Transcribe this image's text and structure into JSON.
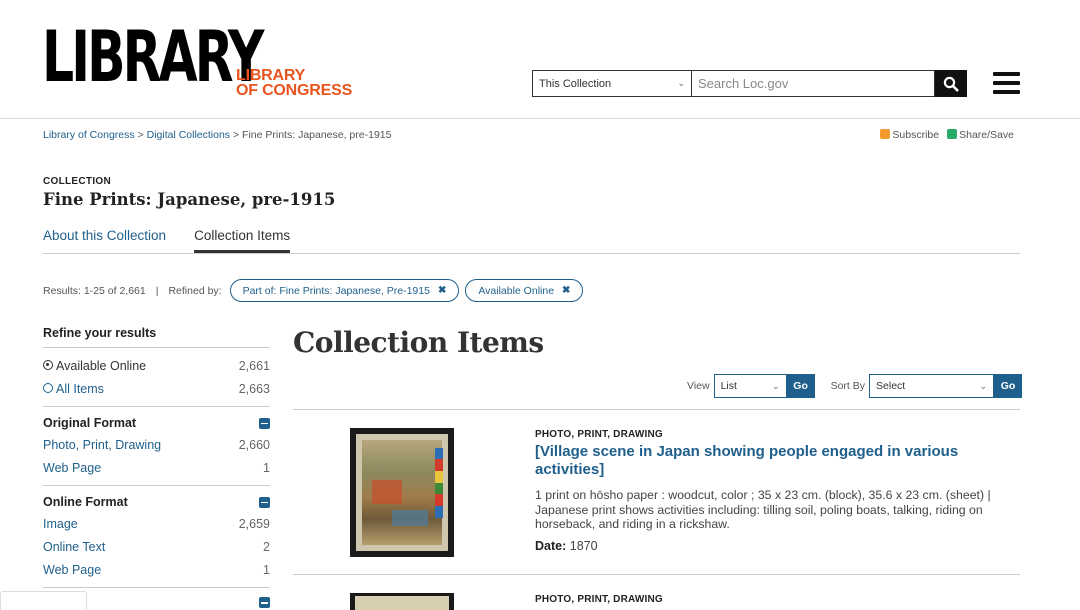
{
  "header": {
    "logo_big": "LIBRARY",
    "logo_small_line1": "LIBRARY",
    "logo_small_line2": "OF CONGRESS",
    "search_scope": "This Collection",
    "search_placeholder": "Search Loc.gov",
    "menu_icon": "hamburger-menu-icon",
    "search_icon": "search-icon"
  },
  "breadcrumb": {
    "items": [
      "Library of Congress",
      "Digital Collections",
      "Fine Prints: Japanese, pre-1915"
    ],
    "separator": ">"
  },
  "tools": {
    "subscribe": "Subscribe",
    "share": "Share/Save"
  },
  "collection": {
    "label": "COLLECTION",
    "title": "Fine Prints: Japanese, pre-1915"
  },
  "tabs": [
    {
      "label": "About this Collection",
      "active": false
    },
    {
      "label": "Collection Items",
      "active": true
    }
  ],
  "results": {
    "summary": "Results: 1-25 of 2,661",
    "separator": "|",
    "refined_by": "Refined by:",
    "filters": [
      "Part of: Fine Prints: Japanese, Pre-1915",
      "Available Online"
    ]
  },
  "sidebar": {
    "heading": "Refine your results",
    "availability": [
      {
        "label": "Available Online",
        "count": "2,661",
        "selected": true
      },
      {
        "label": "All Items",
        "count": "2,663",
        "selected": false
      }
    ],
    "groups": [
      {
        "heading": "Original Format",
        "items": [
          {
            "label": "Photo, Print, Drawing",
            "count": "2,660"
          },
          {
            "label": "Web Page",
            "count": "1"
          }
        ]
      },
      {
        "heading": "Online Format",
        "items": [
          {
            "label": "Image",
            "count": "2,659"
          },
          {
            "label": "Online Text",
            "count": "2"
          },
          {
            "label": "Web Page",
            "count": "1"
          }
        ]
      }
    ]
  },
  "main": {
    "title": "Collection Items",
    "view_label": "View",
    "view_value": "List",
    "sort_label": "Sort By",
    "sort_value": "Select",
    "go_label": "Go"
  },
  "items": [
    {
      "kind": "PHOTO, PRINT, DRAWING",
      "title": "[Village scene in Japan showing people engaged in various activities]",
      "description": "1 print on hōsho paper : woodcut, color ; 35 x 23 cm. (block), 35.6 x 23 cm. (sheet) | Japanese print shows activities including: tilling soil, poling boats, talking, riding on horseback, and riding in a rickshaw.",
      "date_label": "Date:",
      "date": "1870"
    },
    {
      "kind": "PHOTO, PRINT, DRAWING"
    }
  ],
  "colors": {
    "link": "#1f5f8b",
    "accent_orange": "#e9541f",
    "text": "#333333"
  }
}
